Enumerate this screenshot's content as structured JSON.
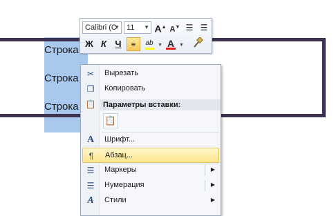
{
  "document": {
    "lines": [
      "Строка",
      "Строка",
      "Строка"
    ]
  },
  "mini_toolbar": {
    "font_name": "Calibri (С",
    "font_size": "11",
    "buttons": {
      "grow_font": "A",
      "shrink_font": "A",
      "bold": "Ж",
      "italic": "К",
      "underline": "Ч",
      "highlight": "ab",
      "font_color": "A"
    }
  },
  "context_menu": {
    "items": {
      "cut": "Вырезать",
      "copy": "Копировать",
      "paste_header": "Параметры вставки:",
      "font": "Шрифт...",
      "paragraph": "Абзац...",
      "bullets": "Маркеры",
      "numbering": "Нумерация",
      "styles": "Стили"
    }
  },
  "colors": {
    "selection": "#a9c8ee",
    "frame": "#3d3350",
    "hover": "#fde58d",
    "font_color_bar": "#e31c1c",
    "highlight_bar": "#ffff00"
  }
}
